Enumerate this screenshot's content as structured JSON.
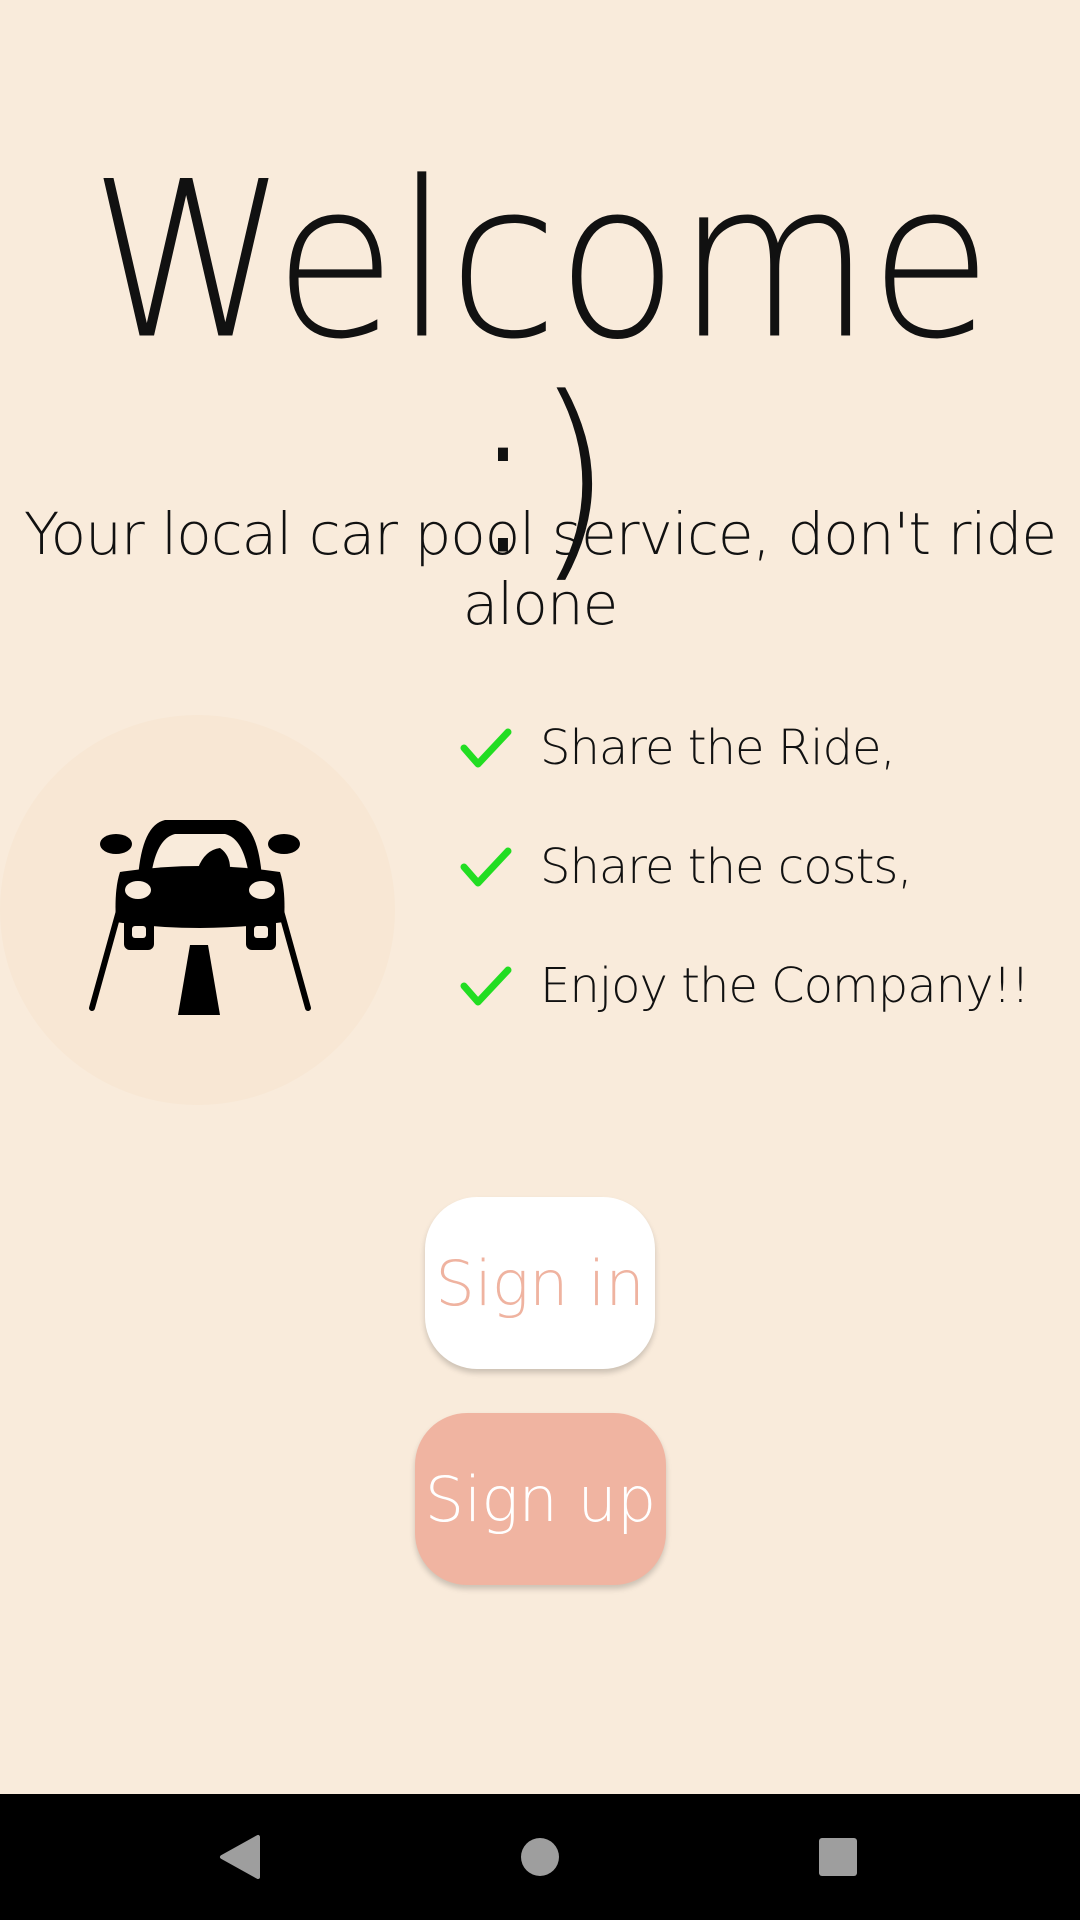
{
  "welcome": {
    "title": "Welcome :)",
    "subtitle": "Your local car pool service, don't ride alone"
  },
  "features": [
    {
      "label": "Share the Ride,"
    },
    {
      "label": "Share the costs,"
    },
    {
      "label": "Enjoy the Company!!"
    }
  ],
  "buttons": {
    "sign_in": "Sign in",
    "sign_up": "Sign up"
  },
  "icons": {
    "car": "car-on-road-icon",
    "check": "checkmark-icon",
    "back": "back-triangle-icon",
    "home": "home-circle-icon",
    "recents": "recents-square-icon"
  },
  "colors": {
    "background": "#f9ebdb",
    "accent": "#f0b4a1",
    "check": "#22dd22",
    "navbar": "#000000"
  }
}
